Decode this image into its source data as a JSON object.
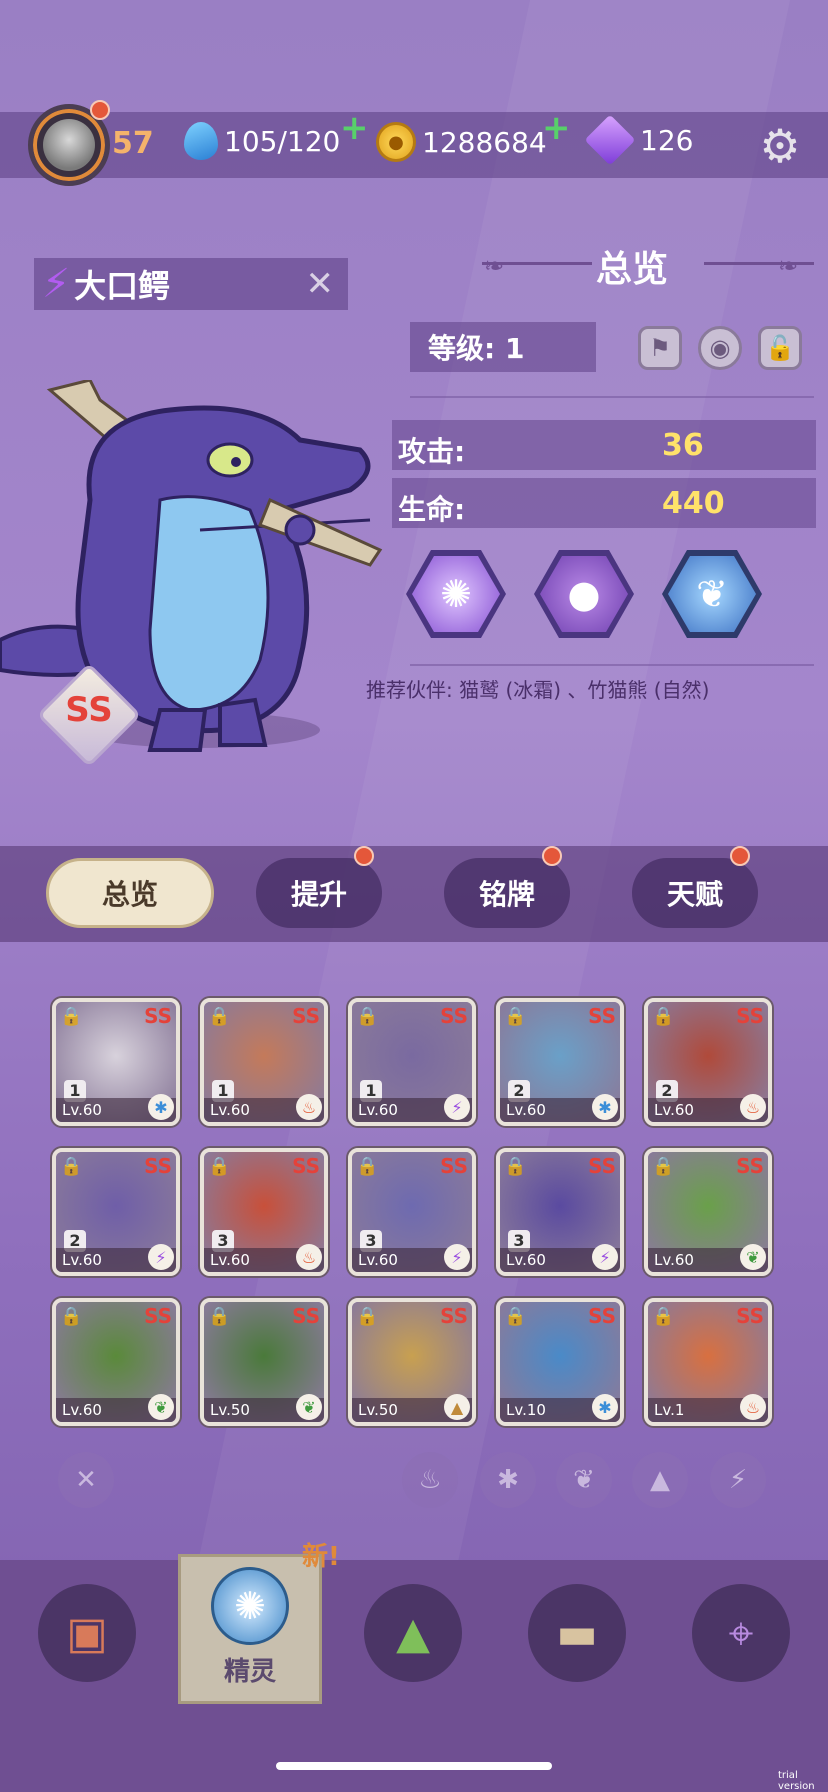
{
  "top": {
    "level": "57",
    "stamina": "105/120",
    "gold": "1288684",
    "gems": "126"
  },
  "spirit": {
    "name": "大口鳄",
    "rank": "SS"
  },
  "panel": {
    "title": "总览",
    "level_label": "等级: 1",
    "attack_label": "攻击:",
    "attack_value": "36",
    "hp_label": "生命:",
    "hp_value": "440",
    "recommend": "推荐伙伴: 猫鹫 (冰霜) 、竹猫熊 (自然)"
  },
  "tabs": [
    {
      "label": "总览"
    },
    {
      "label": "提升"
    },
    {
      "label": "铭牌"
    },
    {
      "label": "天赋"
    }
  ],
  "cards": [
    {
      "rank": "SS",
      "num": "1",
      "lv": "Lv.60",
      "element": "ice"
    },
    {
      "rank": "SS",
      "num": "1",
      "lv": "Lv.60",
      "element": "fire"
    },
    {
      "rank": "SS",
      "num": "1",
      "lv": "Lv.60",
      "element": "thunder"
    },
    {
      "rank": "SS",
      "num": "2",
      "lv": "Lv.60",
      "element": "ice"
    },
    {
      "rank": "SS",
      "num": "2",
      "lv": "Lv.60",
      "element": "fire"
    },
    {
      "rank": "SS",
      "num": "2",
      "lv": "Lv.60",
      "element": "thunder"
    },
    {
      "rank": "SS",
      "num": "3",
      "lv": "Lv.60",
      "element": "fire"
    },
    {
      "rank": "SS",
      "num": "3",
      "lv": "Lv.60",
      "element": "thunder"
    },
    {
      "rank": "SS",
      "num": "3",
      "lv": "Lv.60",
      "element": "thunder"
    },
    {
      "rank": "SS",
      "num": "",
      "lv": "Lv.60",
      "element": "nature"
    },
    {
      "rank": "SS",
      "num": "",
      "lv": "Lv.60",
      "element": "nature"
    },
    {
      "rank": "SS",
      "num": "",
      "lv": "Lv.50",
      "element": "nature"
    },
    {
      "rank": "SS",
      "num": "",
      "lv": "Lv.50",
      "element": "earth"
    },
    {
      "rank": "SS",
      "num": "",
      "lv": "Lv.10",
      "element": "ice"
    },
    {
      "rank": "SS",
      "num": "",
      "lv": "Lv.1",
      "element": "fire"
    }
  ],
  "nav": {
    "active_label": "精灵",
    "new_tag": "新!"
  },
  "watermark": "trial version",
  "colors": {
    "accent_gold": "#ffe26a",
    "rank_red": "#e4423a",
    "tab_active_bg": "#f0e6cf"
  }
}
